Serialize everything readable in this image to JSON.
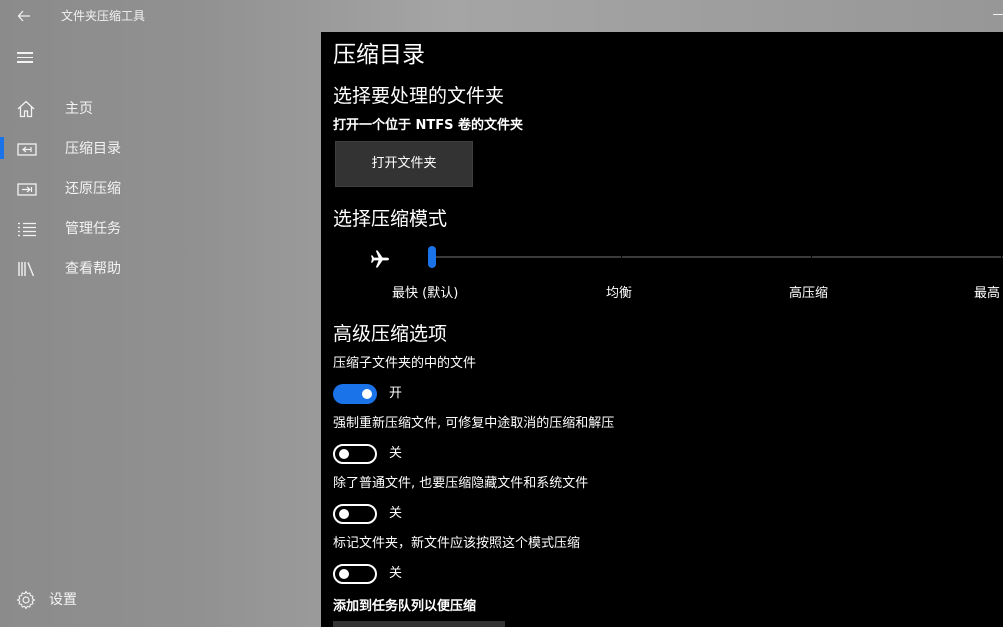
{
  "window": {
    "title": "文件夹压缩工具",
    "back_icon": "back-arrow-icon",
    "minimize_icon": "minimize-icon"
  },
  "nav": {
    "menu_icon": "hamburger-menu-icon",
    "items": [
      {
        "label": "主页",
        "icon": "home-icon",
        "selected": false
      },
      {
        "label": "压缩目录",
        "icon": "compress-folder-icon",
        "selected": true
      },
      {
        "label": "还原压缩",
        "icon": "restore-icon",
        "selected": false
      },
      {
        "label": "管理任务",
        "icon": "task-list-icon",
        "selected": false
      },
      {
        "label": "查看帮助",
        "icon": "library-help-icon",
        "selected": false
      }
    ],
    "settings": {
      "label": "设置",
      "icon": "gear-icon"
    }
  },
  "main": {
    "page_title": "压缩目录",
    "select_folder": {
      "heading": "选择要处理的文件夹",
      "instruction": "打开一个位于 NTFS 卷的文件夹",
      "button_label": "打开文件夹"
    },
    "mode": {
      "heading": "选择压缩模式",
      "icon": "airplane-icon",
      "levels": [
        "最快 (默认)",
        "均衡",
        "高压缩",
        "最高"
      ],
      "selected_index": 0
    },
    "advanced": {
      "heading": "高级压缩选项",
      "options": [
        {
          "label": "压缩子文件夹的中的文件",
          "state_label": "开",
          "on": true
        },
        {
          "label": "强制重新压缩文件, 可修复中途取消的压缩和解压",
          "state_label": "关",
          "on": false
        },
        {
          "label": "除了普通文件, 也要压缩隐藏文件和系统文件",
          "state_label": "关",
          "on": false
        },
        {
          "label": "标记文件夹，新文件应该按照这个模式压缩",
          "state_label": "关",
          "on": false
        }
      ]
    },
    "queue_label": "添加到任务队列以便压缩"
  },
  "colors": {
    "accent": "#1a73e8",
    "content_bg": "#000000",
    "button_bg": "#333333"
  }
}
